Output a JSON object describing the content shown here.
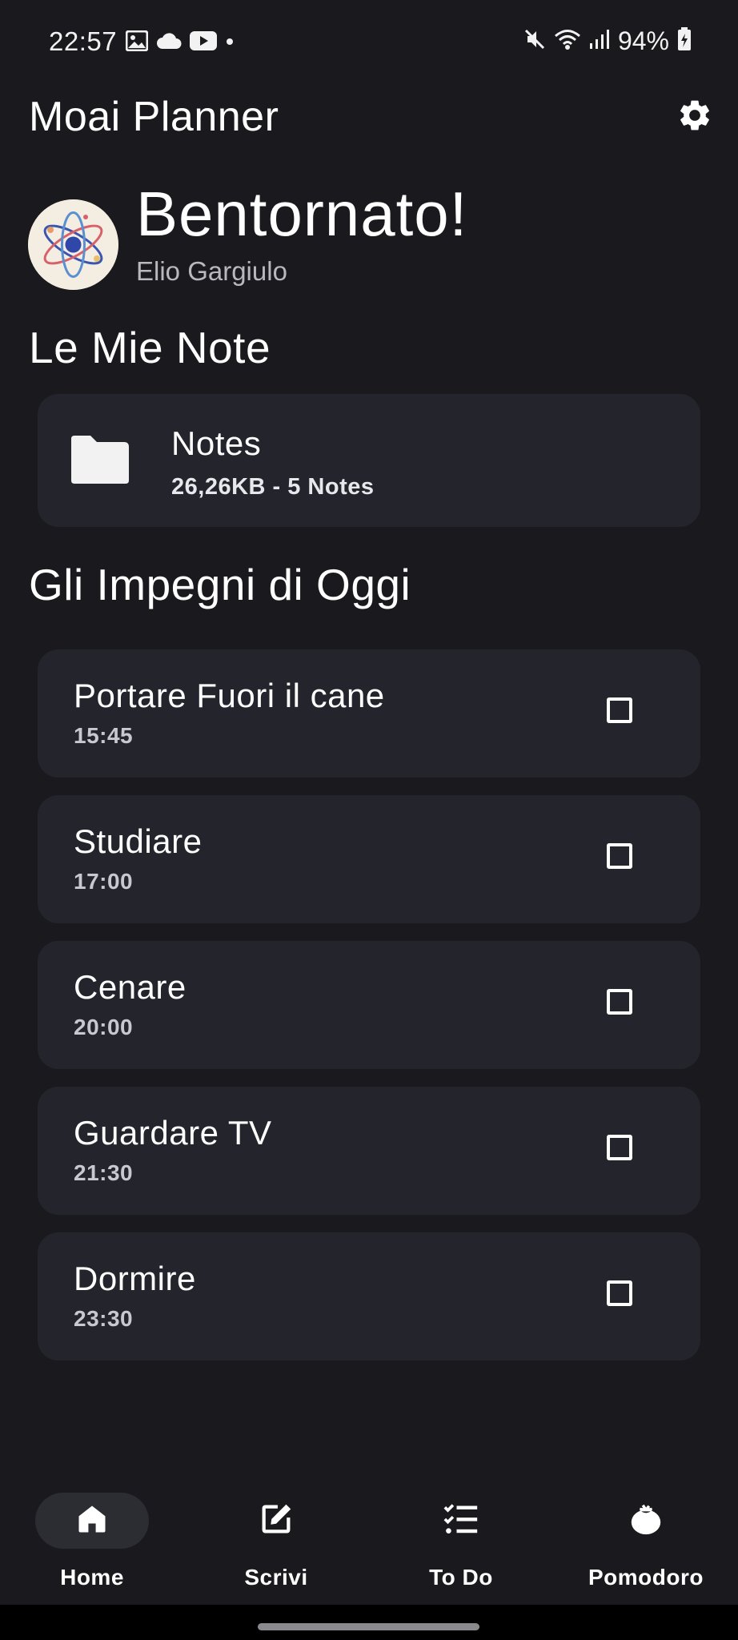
{
  "status_bar": {
    "time": "22:57",
    "battery": "94%",
    "icons": [
      "gallery-icon",
      "cloud-icon",
      "youtube-icon",
      "dot-icon",
      "mute-icon",
      "wifi-icon",
      "signal-icon",
      "battery-icon"
    ]
  },
  "header": {
    "title": "Moai Planner",
    "settings_icon": "gear-icon"
  },
  "welcome": {
    "title": "Bentornato!",
    "user_name": "Elio Gargiulo",
    "avatar_icon": "atom-avatar"
  },
  "notes_section": {
    "title": "Le Mie Note",
    "folder": {
      "name": "Notes",
      "meta": "26,26KB - 5 Notes",
      "icon": "folder-icon"
    }
  },
  "tasks_section": {
    "title": "Gli Impegni di Oggi",
    "tasks": [
      {
        "title": "Portare Fuori il cane",
        "time": "15:45",
        "checked": false
      },
      {
        "title": "Studiare",
        "time": "17:00",
        "checked": false
      },
      {
        "title": "Cenare",
        "time": "20:00",
        "checked": false
      },
      {
        "title": "Guardare TV",
        "time": "21:30",
        "checked": false
      },
      {
        "title": "Dormire",
        "time": "23:30",
        "checked": false
      }
    ]
  },
  "bottom_nav": {
    "items": [
      {
        "label": "Home",
        "icon": "home-icon",
        "active": true
      },
      {
        "label": "Scrivi",
        "icon": "edit-icon",
        "active": false
      },
      {
        "label": "To Do",
        "icon": "checklist-icon",
        "active": false
      },
      {
        "label": "Pomodoro",
        "icon": "tomato-icon",
        "active": false
      }
    ]
  },
  "colors": {
    "background": "#1a1a1e",
    "card": "#24242d",
    "text": "#ffffff",
    "muted_text": "#b8b8be"
  }
}
